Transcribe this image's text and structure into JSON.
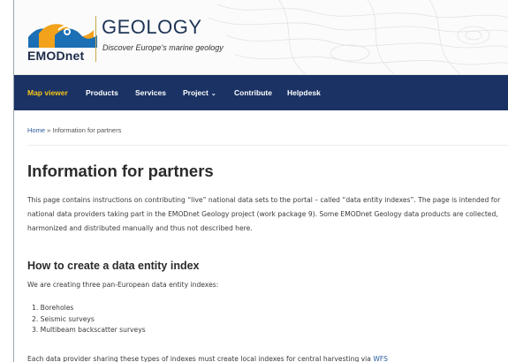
{
  "header": {
    "logo_text": "EMODnet",
    "site_title": "GEOLOGY",
    "site_subtitle": "Discover Europe's marine geology"
  },
  "nav": {
    "items": [
      {
        "label": "Map viewer",
        "active": true
      },
      {
        "label": "Products"
      },
      {
        "label": "Services"
      },
      {
        "label": "Project",
        "has_dropdown": true
      },
      {
        "label": "Contribute"
      },
      {
        "label": "Helpdesk"
      }
    ]
  },
  "breadcrumb": {
    "home": "Home",
    "separator": "»",
    "current": "Information for partners"
  },
  "content": {
    "title": "Information for partners",
    "paragraph": "This page contains instructions on contributing “live” national data sets to the portal – called “data entity indexes”. The page is intended for national data providers taking part in the EMODnet Geology project (work package 9). Some EMODnet Geology data products are collected, harmonized and distributed manually and thus not described here.",
    "section_title": "How to create a data entity index",
    "section_intro": "We are creating three pan-European data entity indexes:",
    "list": [
      "1. Boreholes",
      "2. Seismic surveys",
      "3. Multibeam backscatter surveys"
    ],
    "bottom_text": "Each data provider sharing these types of indexes must create local indexes for central harvesting via",
    "bottom_link": "WFS"
  },
  "colors": {
    "nav_bg": "#1a3264",
    "nav_active": "#f5c518",
    "link": "#2a5aa0",
    "title": "#1f3556"
  }
}
